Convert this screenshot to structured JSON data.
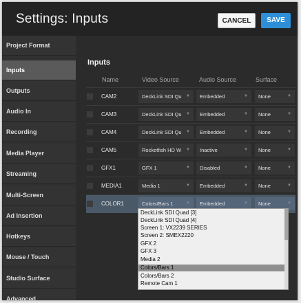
{
  "header": {
    "title": "Settings: Inputs",
    "cancel_label": "CANCEL",
    "save_label": "SAVE"
  },
  "sidebar": {
    "items": [
      {
        "label": "Project Format"
      },
      {
        "label": "Inputs",
        "active": true
      },
      {
        "label": "Outputs"
      },
      {
        "label": "Audio In"
      },
      {
        "label": "Recording"
      },
      {
        "label": "Media Player"
      },
      {
        "label": "Streaming"
      },
      {
        "label": "Multi-Screen"
      },
      {
        "label": "Ad Insertion"
      },
      {
        "label": "Hotkeys"
      },
      {
        "label": "Mouse / Touch"
      },
      {
        "label": "Studio Surface"
      },
      {
        "label": "Advanced"
      }
    ]
  },
  "main": {
    "section_title": "Inputs",
    "columns": {
      "name": "Name",
      "video": "Video Source",
      "audio": "Audio Source",
      "surface": "Surface"
    },
    "rows": [
      {
        "name": "CAM2",
        "video": "DeckLink SDI Qu",
        "audio": "Embedded",
        "surface": "None"
      },
      {
        "name": "CAM3",
        "video": "DeckLink SDI Qu",
        "audio": "Embedded",
        "surface": "None"
      },
      {
        "name": "CAM4",
        "video": "DeckLink SDI Qu",
        "audio": "Embedded",
        "surface": "None"
      },
      {
        "name": "CAM5",
        "video": "Rocketfish HD W",
        "audio": "Inactive",
        "surface": "None"
      },
      {
        "name": "GFX1",
        "video": "GFX 1",
        "audio": "Disabled",
        "surface": "None"
      },
      {
        "name": "MEDIA1",
        "video": "Media 1",
        "audio": "Embedded",
        "surface": "None"
      },
      {
        "name": "COLOR1",
        "video": "Colors/Bars 1",
        "audio": "Embedded",
        "surface": "None",
        "selected": true
      }
    ]
  },
  "video_dropdown": {
    "options": [
      "DeckLink SDI Quad [3]",
      "DeckLink SDI Quad [4]",
      "Screen 1: VX2239 SERIES",
      "Screen 2: SMEX2220",
      "GFX 2",
      "GFX 3",
      "Media 2",
      "Colors/Bars 1",
      "Colors/Bars 2",
      "Remote Cam 1"
    ],
    "highlighted": "Colors/Bars 1"
  }
}
